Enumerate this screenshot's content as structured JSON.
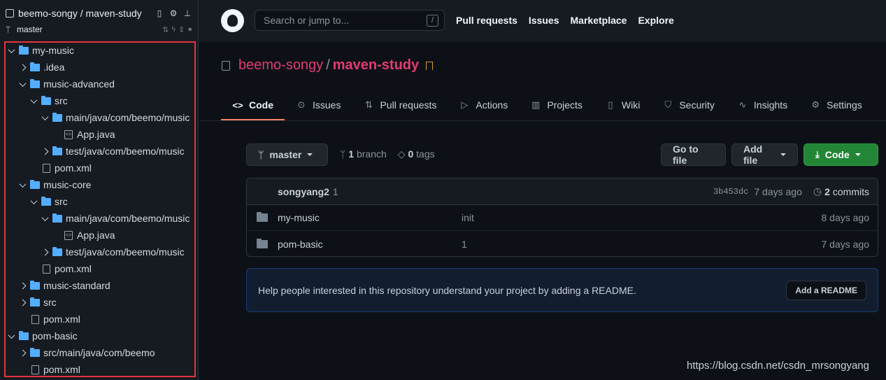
{
  "sidebar": {
    "title": "beemo-songy / maven-study",
    "branch": "master",
    "tree": [
      {
        "label": "my-music",
        "depth": 0,
        "type": "folder",
        "state": "open"
      },
      {
        "label": ".idea",
        "depth": 1,
        "type": "folder",
        "state": "closed"
      },
      {
        "label": "music-advanced",
        "depth": 1,
        "type": "folder",
        "state": "open"
      },
      {
        "label": "src",
        "depth": 2,
        "type": "folder",
        "state": "open"
      },
      {
        "label": "main/java/com/beemo/music",
        "depth": 3,
        "type": "folder",
        "state": "open"
      },
      {
        "label": "App.java",
        "depth": 4,
        "type": "code"
      },
      {
        "label": "test/java/com/beemo/music",
        "depth": 3,
        "type": "folder",
        "state": "closed"
      },
      {
        "label": "pom.xml",
        "depth": 2,
        "type": "file"
      },
      {
        "label": "music-core",
        "depth": 1,
        "type": "folder",
        "state": "open"
      },
      {
        "label": "src",
        "depth": 2,
        "type": "folder",
        "state": "open"
      },
      {
        "label": "main/java/com/beemo/music",
        "depth": 3,
        "type": "folder",
        "state": "open"
      },
      {
        "label": "App.java",
        "depth": 4,
        "type": "code"
      },
      {
        "label": "test/java/com/beemo/music",
        "depth": 3,
        "type": "folder",
        "state": "closed"
      },
      {
        "label": "pom.xml",
        "depth": 2,
        "type": "file"
      },
      {
        "label": "music-standard",
        "depth": 1,
        "type": "folder",
        "state": "closed"
      },
      {
        "label": "src",
        "depth": 1,
        "type": "folder",
        "state": "closed"
      },
      {
        "label": "pom.xml",
        "depth": 1,
        "type": "file"
      },
      {
        "label": "pom-basic",
        "depth": 0,
        "type": "folder",
        "state": "open"
      },
      {
        "label": "src/main/java/com/beemo",
        "depth": 1,
        "type": "folder",
        "state": "closed"
      },
      {
        "label": "pom.xml",
        "depth": 1,
        "type": "file"
      }
    ]
  },
  "header": {
    "search_placeholder": "Search or jump to...",
    "search_shortcut": "/",
    "nav": [
      "Pull requests",
      "Issues",
      "Marketplace",
      "Explore"
    ]
  },
  "repo": {
    "owner": "beemo-songy",
    "separator": "/",
    "name": "maven-study"
  },
  "tabs": [
    {
      "label": "Code",
      "icon": "<>",
      "active": true
    },
    {
      "label": "Issues",
      "icon": "⊙",
      "active": false
    },
    {
      "label": "Pull requests",
      "icon": "⇅",
      "active": false
    },
    {
      "label": "Actions",
      "icon": "▷",
      "active": false
    },
    {
      "label": "Projects",
      "icon": "▥",
      "active": false
    },
    {
      "label": "Wiki",
      "icon": "▯",
      "active": false
    },
    {
      "label": "Security",
      "icon": "⛉",
      "active": false
    },
    {
      "label": "Insights",
      "icon": "∿",
      "active": false
    },
    {
      "label": "Settings",
      "icon": "⚙",
      "active": false
    }
  ],
  "toolbar": {
    "branch": "master",
    "branch_count": "1",
    "branch_label": "branch",
    "tag_count": "0",
    "tag_label": "tags",
    "go_to_file": "Go to file",
    "add_file": "Add file",
    "code": "Code"
  },
  "commit": {
    "author": "songyang2",
    "message": "1",
    "sha": "3b453dc",
    "age": "7 days ago",
    "commit_count": "2",
    "commit_label": "commits"
  },
  "files": [
    {
      "name": "my-music",
      "message": "init",
      "age": "8 days ago"
    },
    {
      "name": "pom-basic",
      "message": "1",
      "age": "7 days ago"
    }
  ],
  "readme": {
    "text": "Help people interested in this repository understand your project by adding a README.",
    "button": "Add a README"
  },
  "watermark": "https://blog.csdn.net/csdn_mrsongyang"
}
